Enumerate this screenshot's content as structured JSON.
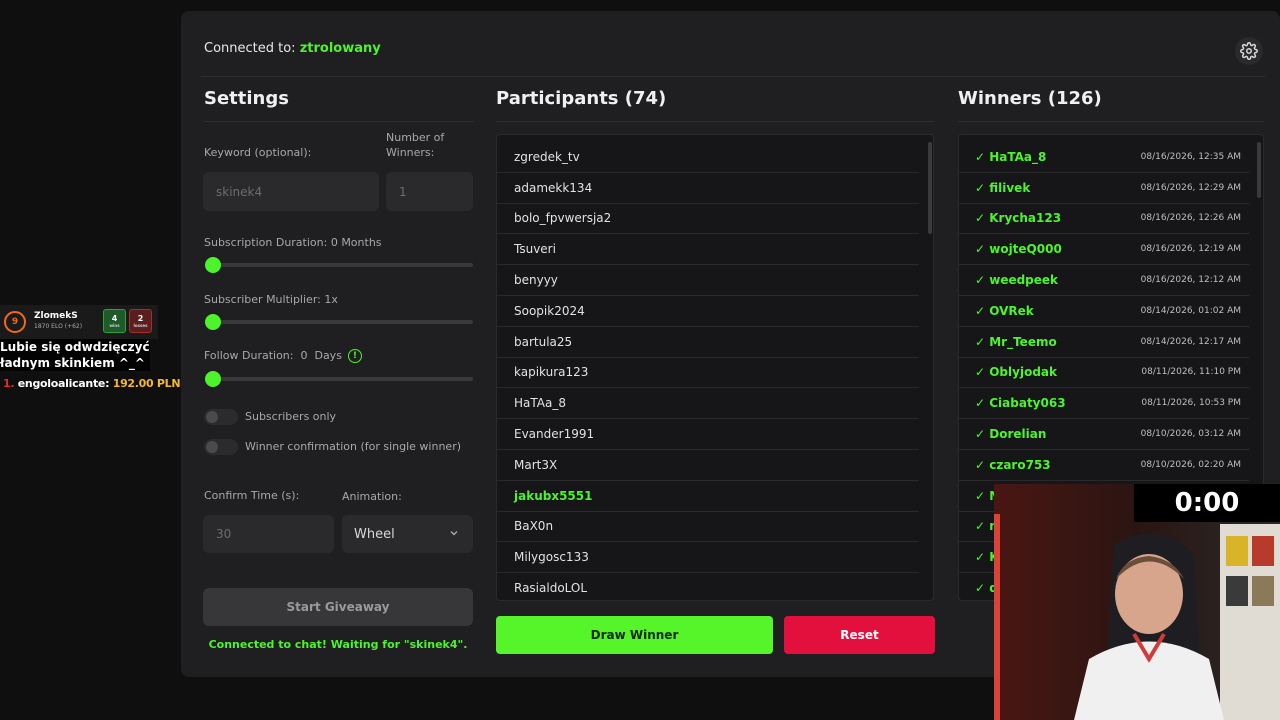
{
  "header": {
    "connected_prefix": "Connected to:",
    "channel": "ztrolowany"
  },
  "settings": {
    "title": "Settings",
    "keyword_label": "Keyword (optional):",
    "keyword_placeholder": "skinek4",
    "winners_label": "Number of Winners:",
    "winners_placeholder": "1",
    "sub_duration_label": "Subscription Duration: 0 Months",
    "sub_multiplier_label": "Subscriber Multiplier: 1x",
    "follow_label": "Follow Duration:  0  Days",
    "subs_only_label": "Subscribers only",
    "winner_confirm_label": "Winner confirmation (for single winner)",
    "confirm_time_label": "Confirm Time (s):",
    "confirm_time_placeholder": "30",
    "animation_label": "Animation:",
    "animation_value": "Wheel",
    "start_button": "Start Giveaway",
    "status": "Connected to chat! Waiting for \"skinek4\"."
  },
  "participants": {
    "title": "Participants (74)",
    "items": [
      {
        "name": "zgredek_tv"
      },
      {
        "name": "adamekk134"
      },
      {
        "name": "bolo_fpvwersja2"
      },
      {
        "name": "Tsuveri"
      },
      {
        "name": "benyyy"
      },
      {
        "name": "Soopik2024"
      },
      {
        "name": "bartula25"
      },
      {
        "name": "kapikura123"
      },
      {
        "name": "HaTAa_8"
      },
      {
        "name": "Evander1991"
      },
      {
        "name": "Mart3X"
      },
      {
        "name": "jakubx5551",
        "highlight": true
      },
      {
        "name": "BaX0n"
      },
      {
        "name": "Milygosc133"
      },
      {
        "name": "RasialdoLOL"
      }
    ],
    "draw_button": "Draw Winner",
    "reset_button": "Reset"
  },
  "winners": {
    "title": "Winners (126)",
    "items": [
      {
        "name": "✓ HaTAa_8",
        "date": "08/16/2026, 12:35 AM"
      },
      {
        "name": "✓ filivek",
        "date": "08/16/2026, 12:29 AM"
      },
      {
        "name": "✓ Krycha123",
        "date": "08/16/2026, 12:26 AM"
      },
      {
        "name": "✓ wojteQ000",
        "date": "08/16/2026, 12:19 AM"
      },
      {
        "name": "✓ weedpeek",
        "date": "08/16/2026, 12:12 AM"
      },
      {
        "name": "✓ OVRek",
        "date": "08/14/2026, 01:02 AM"
      },
      {
        "name": "✓ Mr_Teemo",
        "date": "08/14/2026, 12:17 AM"
      },
      {
        "name": "✓ Oblyjodak",
        "date": "08/11/2026, 11:10 PM"
      },
      {
        "name": "✓ Ciabaty063",
        "date": "08/11/2026, 10:53 PM"
      },
      {
        "name": "✓ Dorelian",
        "date": "08/10/2026, 03:12 AM"
      },
      {
        "name": "✓ czaro753",
        "date": "08/10/2026, 02:20 AM"
      },
      {
        "name": "✓ MiniJohnnyPoland",
        "date": ""
      },
      {
        "name": "✓ n",
        "date": ""
      },
      {
        "name": "✓ K",
        "date": ""
      },
      {
        "name": "✓ d",
        "date": ""
      }
    ]
  },
  "overlay": {
    "player_level": "9",
    "player_name": "ZlomekS",
    "player_elo": "1870 ELO (+62)",
    "wins": "4",
    "wins_label": "wins",
    "losses": "2",
    "losses_label": "losses",
    "message_line1": "Lubie się odwdzięczyć",
    "message_line2": "ładnym skinkiem ^_^",
    "donation_rank": "1.",
    "donation_name": "engoloalicante:",
    "donation_amount": "192.00 PLN",
    "timer": "0:00"
  },
  "colors": {
    "accent": "#4cf42c",
    "reset": "#e3103d",
    "panel": "#1f1f21"
  },
  "icons": {
    "settings": "gear-icon",
    "info": "info-icon",
    "dropdown": "chevron-down-icon"
  }
}
